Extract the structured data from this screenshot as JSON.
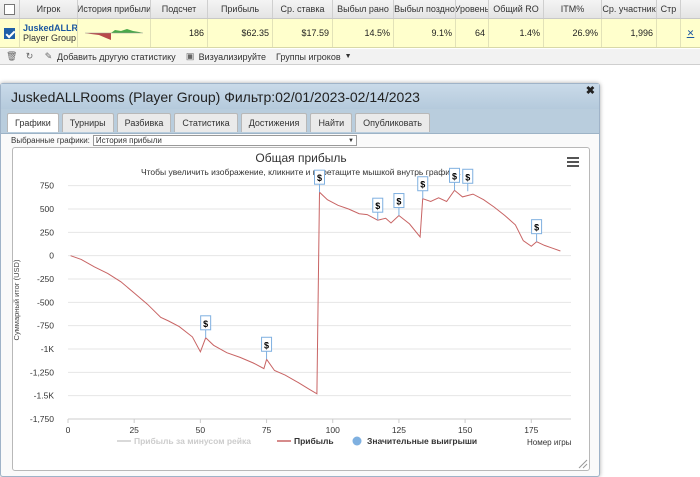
{
  "grid": {
    "headers": [
      "Игрок",
      "История прибыли",
      "Подсчет",
      "Прибыль",
      "Ср. ставка",
      "Выбыл рано",
      "Выбыл поздно",
      "Уровень",
      "Общий RO",
      "ITM%",
      "Ср. участник",
      "Стр"
    ],
    "row": {
      "player_name": "JuskedALLRooms",
      "player_group": "Player Group",
      "values": [
        "186",
        "$62.35",
        "$17.59",
        "14.5%",
        "9.1%",
        "64",
        "1.4%",
        "26.9%",
        "1,996"
      ]
    }
  },
  "toolbar": {
    "add_stats": "Добавить другую статистику",
    "visualize": "Визуализируйте",
    "player_groups": "Группы игроков"
  },
  "dialog": {
    "title": "JuskedALLRooms (Player Group) Фильтр:02/01/2023-02/14/2023",
    "tabs": [
      "Графики",
      "Турниры",
      "Разбивка",
      "Статистика",
      "Достижения",
      "Найти",
      "Опубликовать"
    ],
    "active_tab": 0,
    "select_label": "Выбранные графики:",
    "select_value": "История прибыли"
  },
  "chart_data": {
    "type": "line",
    "title": "Общая прибыль",
    "subtitle": "Чтобы увеличить изображение, кликните и перетащите мышкой внутрь графика.",
    "xlabel": "Номер игры",
    "ylabel": "Суммарный итог (USD)",
    "xlim": [
      0,
      190
    ],
    "ylim": [
      -1750,
      800
    ],
    "x_ticks": [
      0,
      25,
      50,
      75,
      100,
      125,
      150,
      175
    ],
    "y_ticks": [
      {
        "v": 750,
        "label": "750"
      },
      {
        "v": 500,
        "label": "500"
      },
      {
        "v": 250,
        "label": "250"
      },
      {
        "v": 0,
        "label": "0"
      },
      {
        "v": -250,
        "label": "-250"
      },
      {
        "v": -500,
        "label": "-500"
      },
      {
        "v": -750,
        "label": "-750"
      },
      {
        "v": -1000,
        "label": "-1K"
      },
      {
        "v": -1250,
        "label": "-1,250"
      },
      {
        "v": -1500,
        "label": "-1.5K"
      },
      {
        "v": -1750,
        "label": "-1,750"
      }
    ],
    "legend": [
      "Прибыль за минусом рейка",
      "Прибыль",
      "Значительные выигрыши"
    ],
    "series": [
      {
        "name": "Прибыль",
        "color": "#c86464",
        "points": [
          [
            1,
            0
          ],
          [
            5,
            -40
          ],
          [
            10,
            -120
          ],
          [
            15,
            -190
          ],
          [
            20,
            -280
          ],
          [
            25,
            -400
          ],
          [
            30,
            -520
          ],
          [
            35,
            -660
          ],
          [
            38,
            -700
          ],
          [
            42,
            -760
          ],
          [
            47,
            -870
          ],
          [
            50,
            -1030
          ],
          [
            52,
            -880
          ],
          [
            55,
            -960
          ],
          [
            60,
            -1040
          ],
          [
            65,
            -1090
          ],
          [
            70,
            -1150
          ],
          [
            74,
            -1210
          ],
          [
            75,
            -1110
          ],
          [
            78,
            -1230
          ],
          [
            82,
            -1280
          ],
          [
            87,
            -1360
          ],
          [
            91,
            -1430
          ],
          [
            94,
            -1480
          ],
          [
            95,
            680
          ],
          [
            98,
            600
          ],
          [
            102,
            540
          ],
          [
            106,
            500
          ],
          [
            110,
            450
          ],
          [
            113,
            440
          ],
          [
            117,
            380
          ],
          [
            120,
            400
          ],
          [
            122,
            350
          ],
          [
            125,
            430
          ],
          [
            129,
            340
          ],
          [
            133,
            200
          ],
          [
            134,
            610
          ],
          [
            137,
            580
          ],
          [
            140,
            620
          ],
          [
            143,
            580
          ],
          [
            146,
            700
          ],
          [
            149,
            630
          ],
          [
            153,
            660
          ],
          [
            157,
            600
          ],
          [
            161,
            520
          ],
          [
            165,
            430
          ],
          [
            169,
            330
          ],
          [
            172,
            160
          ],
          [
            175,
            100
          ],
          [
            177,
            150
          ],
          [
            180,
            110
          ],
          [
            183,
            80
          ],
          [
            186,
            50
          ]
        ]
      }
    ],
    "big_wins": [
      [
        75,
        -1110
      ],
      [
        52,
        -880
      ],
      [
        95,
        680
      ],
      [
        117,
        380
      ],
      [
        125,
        430
      ],
      [
        134,
        610
      ],
      [
        146,
        700
      ],
      [
        151,
        690
      ],
      [
        177,
        150
      ]
    ],
    "big_win_symbol": "$"
  }
}
